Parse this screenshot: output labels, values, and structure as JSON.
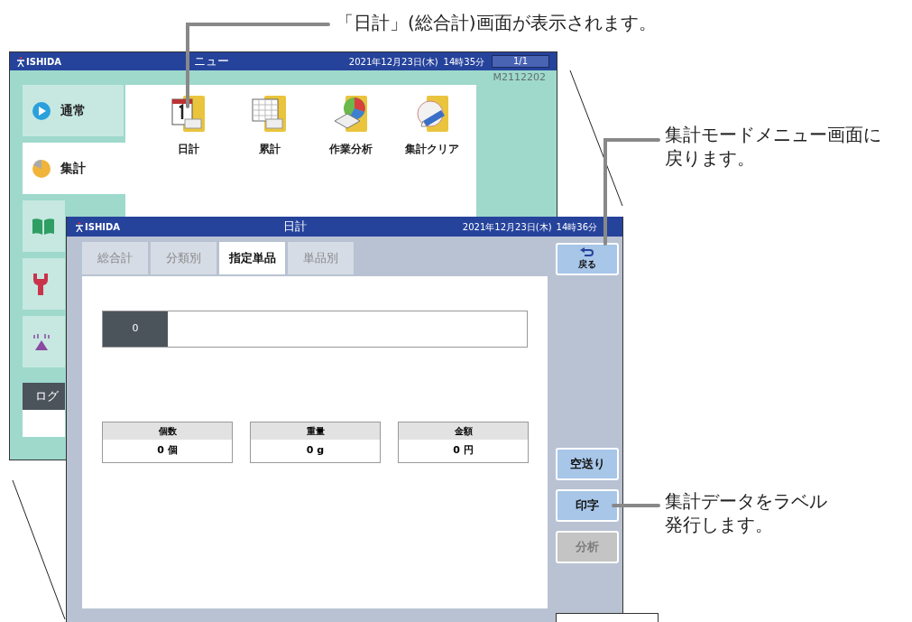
{
  "callouts": [
    {
      "lines": [
        "「日計」(総合計)画面が表示されます。"
      ]
    },
    {
      "lines": [
        "集計モードメニュー画面に",
        "戻ります。"
      ]
    },
    {
      "lines": [
        "集計データをラベル",
        "発行します。"
      ]
    }
  ],
  "menu_screen": {
    "logo": "ISHIDA",
    "title": "ニュー",
    "date": "2021年12月23日(木)",
    "time": "14時35分",
    "page": "1/1",
    "model_code": "M2112202",
    "sidebar": {
      "items": [
        {
          "kind": "play",
          "label": "通常",
          "selected": false
        },
        {
          "kind": "pie",
          "label": "集計",
          "selected": true
        },
        {
          "kind": "book",
          "selected": false
        },
        {
          "kind": "wrench",
          "selected": false
        },
        {
          "kind": "antenna",
          "selected": false
        }
      ]
    },
    "logout": "ログ",
    "menu_items": [
      {
        "kind": "day",
        "label": "日計"
      },
      {
        "kind": "total",
        "label": "累計"
      },
      {
        "kind": "analysis",
        "label": "作業分析"
      },
      {
        "kind": "clear",
        "label": "集計クリア"
      }
    ]
  },
  "daily_screen": {
    "logo": "ISHIDA",
    "title": "日計",
    "date": "2021年12月23日(木)",
    "time": "14時36分",
    "tabs": [
      {
        "label": "総合計",
        "selected": false
      },
      {
        "label": "分類別",
        "selected": false
      },
      {
        "label": "指定単品",
        "selected": true
      },
      {
        "label": "単品別",
        "selected": false
      }
    ],
    "counter": "0",
    "summary": [
      {
        "label": "個数",
        "value": "0 個"
      },
      {
        "label": "重量",
        "value": "0 g"
      },
      {
        "label": "金額",
        "value": "0 円"
      }
    ],
    "buttons": [
      {
        "kind": "back",
        "label": "戻る",
        "disabled": false
      },
      {
        "kind": "action",
        "label": "空送り",
        "disabled": false
      },
      {
        "kind": "action",
        "label": "印字",
        "disabled": false
      },
      {
        "kind": "action",
        "label": "分析",
        "disabled": true
      }
    ]
  }
}
